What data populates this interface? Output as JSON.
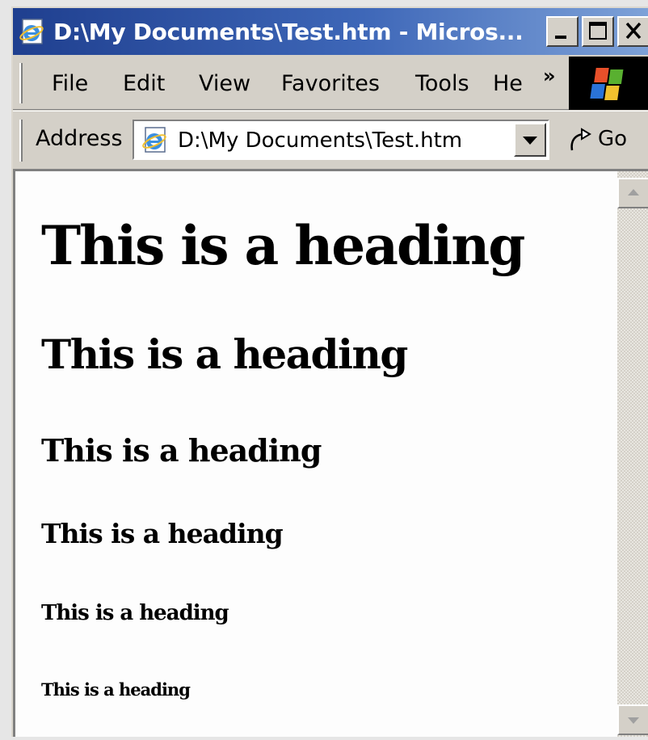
{
  "window": {
    "title": "D:\\My Documents\\Test.htm - Micros...",
    "title_icon": "ie-page-icon"
  },
  "menu": {
    "items": [
      "File",
      "Edit",
      "View",
      "Favorites",
      "Tools",
      "He"
    ],
    "overflow": "»"
  },
  "address_bar": {
    "label": "Address",
    "value": "D:\\My Documents\\Test.htm",
    "go_label": "Go"
  },
  "content": {
    "headings": [
      "This is a heading",
      "This is a heading",
      "This is a heading",
      "This is a heading",
      "This is a heading",
      "This is a heading"
    ]
  },
  "colors": {
    "titlebar_start": "#1f3f8f",
    "titlebar_end": "#7ea2d8",
    "chrome": "#d4d0c8",
    "page_background": "#fdfdfd"
  }
}
